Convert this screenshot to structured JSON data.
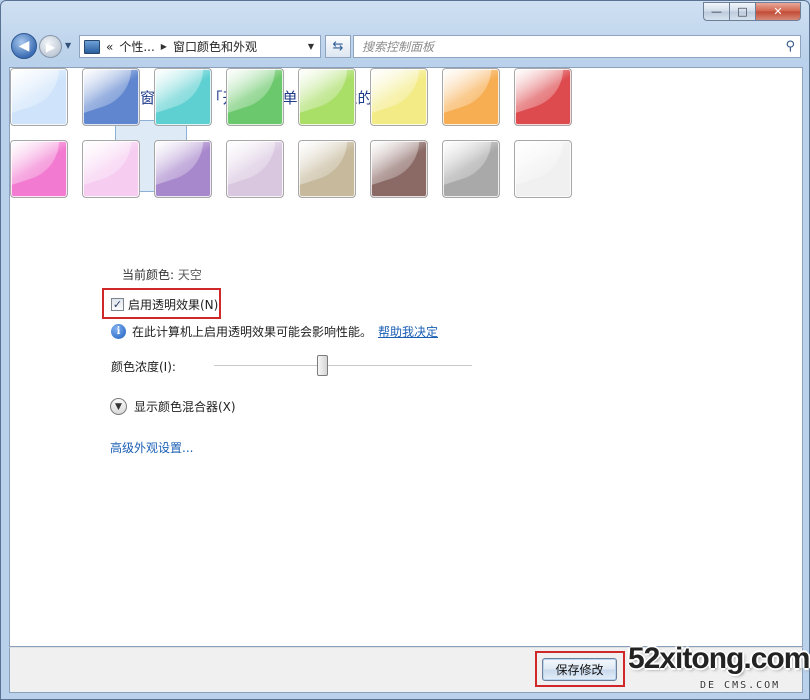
{
  "window": {
    "caption_buttons": {
      "minimize": "—",
      "maximize": "□",
      "close": "✕"
    }
  },
  "nav": {
    "breadcrumb_prefix": "«",
    "breadcrumbs": [
      "个性...",
      "窗口颜色和外观"
    ],
    "search_placeholder": "搜索控制面板"
  },
  "main": {
    "heading": "更改窗口边框、「开始」菜单和任务栏的颜色",
    "swatches": [
      {
        "name": "sky",
        "color": "#cfe4fb"
      },
      {
        "name": "twilight",
        "color": "#5f86cf"
      },
      {
        "name": "sea",
        "color": "#5fd0d2"
      },
      {
        "name": "leaf",
        "color": "#6cc86c"
      },
      {
        "name": "lime",
        "color": "#a9de67"
      },
      {
        "name": "lemon",
        "color": "#f3eb86"
      },
      {
        "name": "pumpkin",
        "color": "#f7ae52"
      },
      {
        "name": "ruby",
        "color": "#dd4b4f"
      },
      {
        "name": "fuchsia",
        "color": "#f27ad0"
      },
      {
        "name": "blush",
        "color": "#f6cdf1"
      },
      {
        "name": "violet",
        "color": "#a888cc"
      },
      {
        "name": "lavender",
        "color": "#d9c7e0"
      },
      {
        "name": "taupe",
        "color": "#c6b99c"
      },
      {
        "name": "chocolate",
        "color": "#8b6a66"
      },
      {
        "name": "slate",
        "color": "#a9a9a9"
      },
      {
        "name": "frost",
        "color": "#f0f0f0"
      }
    ],
    "selected_swatch": 0,
    "current_color_label": "当前颜色:",
    "current_color_value": "天空",
    "transparency_label": "启用透明效果(N)",
    "transparency_checked": true,
    "info_text": "在此计算机上启用透明效果可能会影响性能。",
    "info_link": "帮助我决定",
    "intensity_label": "颜色浓度(I):",
    "intensity_value": 0.42,
    "mixer_label": "显示颜色混合器(X)",
    "advanced_link": "高级外观设置..."
  },
  "footer": {
    "save_label": "保存修改"
  },
  "watermark": {
    "main": "52xitong.com",
    "sub": "DE  CMS.COM"
  }
}
